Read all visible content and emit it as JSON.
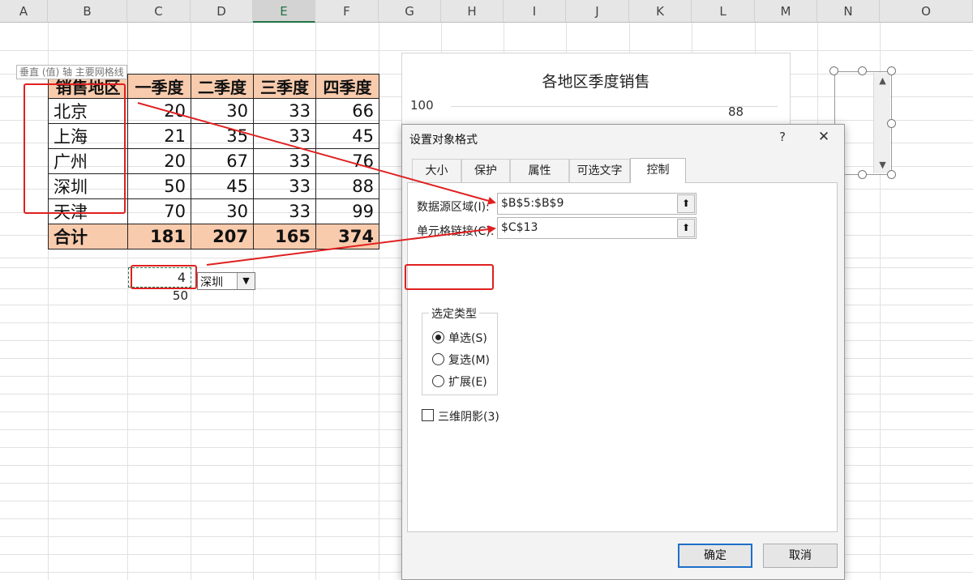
{
  "columns": [
    "A",
    "B",
    "C",
    "D",
    "E",
    "F",
    "G",
    "H",
    "I",
    "J",
    "K",
    "L",
    "M",
    "N",
    "O"
  ],
  "selected_column": "E",
  "table": {
    "header": [
      "销售地区",
      "一季度",
      "二季度",
      "三季度",
      "四季度"
    ],
    "rows": [
      {
        "region": "北京",
        "q": [
          20,
          30,
          33,
          66
        ]
      },
      {
        "region": "上海",
        "q": [
          21,
          35,
          33,
          45
        ]
      },
      {
        "region": "广州",
        "q": [
          20,
          67,
          33,
          76
        ]
      },
      {
        "region": "深圳",
        "q": [
          50,
          45,
          33,
          88
        ]
      },
      {
        "region": "天津",
        "q": [
          70,
          30,
          33,
          99
        ]
      }
    ],
    "total": {
      "label": "合计",
      "q": [
        181,
        207,
        165,
        374
      ]
    }
  },
  "tooltip": "垂直 (值) 轴 主要网格线",
  "cells": {
    "c13": "4",
    "c14": "50"
  },
  "combo": {
    "value": "深圳",
    "arrow": "▼"
  },
  "chart": {
    "title": "各地区季度销售",
    "ytick": "100",
    "data_label": "88"
  },
  "scrollbar": {
    "up": "▲",
    "down": "▼"
  },
  "dialog": {
    "title": "设置对象格式",
    "help": "?",
    "close": "✕",
    "tabs": [
      "大小",
      "保护",
      "属性",
      "可选文字",
      "控制"
    ],
    "active_tab": "控制",
    "data_range_label": "数据源区域(I):",
    "data_range_value": "$B$5:$B$9",
    "cell_link_label": "单元格链接(C):",
    "cell_link_value": "$C$13",
    "up_button": "⬆",
    "selection_type_title": "选定类型",
    "options": [
      {
        "label": "单选(S)",
        "checked": true
      },
      {
        "label": "复选(M)",
        "checked": false
      },
      {
        "label": "扩展(E)",
        "checked": false
      }
    ],
    "shading_label": "三维阴影(3)",
    "ok_label": "确定",
    "cancel_label": "取消"
  },
  "colors": {
    "header_fill": "#f8cbad",
    "annotation": "#e02020",
    "accent": "#217346",
    "default_button_border": "#1e6fc8"
  }
}
